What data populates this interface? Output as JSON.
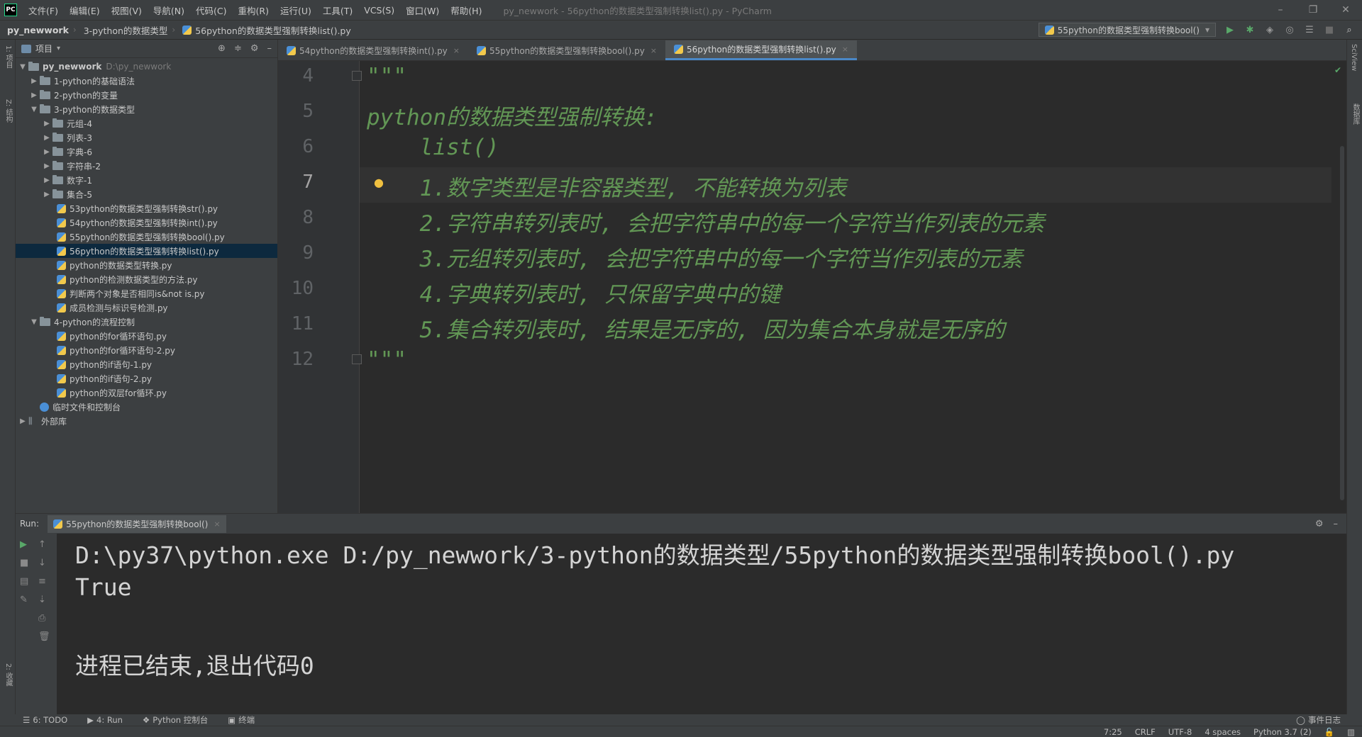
{
  "menu": {
    "items": [
      "文件(F)",
      "编辑(E)",
      "视图(V)",
      "导航(N)",
      "代码(C)",
      "重构(R)",
      "运行(U)",
      "工具(T)",
      "VCS(S)",
      "窗口(W)",
      "帮助(H)"
    ],
    "window_title": "py_newwork - 56python的数据类型强制转换list().py - PyCharm"
  },
  "breadcrumb": {
    "project": "py_newwork",
    "folder": "3-python的数据类型",
    "file": "56python的数据类型强制转换list().py"
  },
  "run_config": {
    "label": "55python的数据类型强制转换bool()"
  },
  "project_panel": {
    "title": "项目",
    "root": {
      "name": "py_newwork",
      "path": "D:\\py_newwork"
    },
    "folders_top": [
      "1-python的基础语法",
      "2-python的变量"
    ],
    "folder_open": "3-python的数据类型",
    "subfolders": [
      "元组-4",
      "列表-3",
      "字典-6",
      "字符串-2",
      "数字-1",
      "集合-5"
    ],
    "files": [
      "53python的数据类型强制转换str().py",
      "54python的数据类型强制转换int().py",
      "55python的数据类型强制转换bool().py",
      "56python的数据类型强制转换list().py",
      "python的数据类型转换.py",
      "python的检测数据类型的方法.py",
      "判断两个对象是否相同is&not is.py",
      "成员检测与标识号检测.py"
    ],
    "folder4": "4-python的流程控制",
    "files4": [
      "python的for循环语句.py",
      "python的for循环语句-2.py",
      "python的if语句-1.py",
      "python的if语句-2.py",
      "python的双层for循环.py"
    ],
    "scratches": "临时文件和控制台",
    "external": "外部库"
  },
  "editor": {
    "tabs": [
      "54python的数据类型强制转换int().py",
      "55python的数据类型强制转换bool().py",
      "56python的数据类型强制转换list().py"
    ],
    "line_numbers": [
      "4",
      "5",
      "6",
      "7",
      "8",
      "9",
      "10",
      "11",
      "12"
    ],
    "code_lines": [
      "\"\"\"",
      "python的数据类型强制转换:",
      "    list()",
      "    1.数字类型是非容器类型, 不能转换为列表",
      "    2.字符串转列表时, 会把字符串中的每一个字符当作列表的元素",
      "    3.元组转列表时, 会把字符串中的每一个字符当作列表的元素",
      "    4.字典转列表时, 只保留字典中的键",
      "    5.集合转列表时, 结果是无序的, 因为集合本身就是无序的",
      "\"\"\""
    ]
  },
  "run": {
    "label": "Run:",
    "tab": "55python的数据类型强制转换bool()",
    "output": [
      "D:\\py37\\python.exe D:/py_newwork/3-python的数据类型/55python的数据类型强制转换bool().py",
      "True",
      "",
      "进程已结束,退出代码0"
    ]
  },
  "tool_tabs": [
    "6: TODO",
    "4: Run",
    "Python 控制台",
    "终端"
  ],
  "event_log": "事件日志",
  "status": [
    "7:25",
    "CRLF",
    "UTF-8",
    "4 spaces",
    "Python 3.7 (2)"
  ],
  "side_labels": {
    "left_top": "1: 项目",
    "left_mid": "Z: 结构",
    "left_bottom": "2: 收藏",
    "right_top": "SciView",
    "right_mid": "数据库"
  },
  "colors": {
    "code_comment": "#629755",
    "selection": "#0d293e",
    "background": "#2b2b2b",
    "panel": "#3c3f41"
  }
}
